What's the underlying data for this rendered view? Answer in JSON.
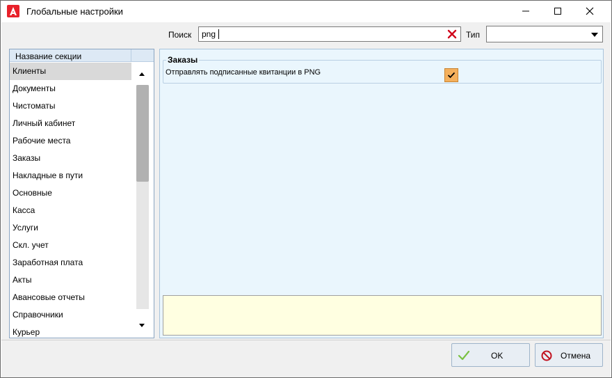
{
  "window": {
    "title": "Глобальные настройки"
  },
  "search": {
    "label": "Поиск",
    "value": "png",
    "clear_icon": "red-x-icon",
    "type_label": "Тип",
    "type_value": ""
  },
  "sections": {
    "header": "Название секции",
    "selected_index": 0,
    "items": [
      "Клиенты",
      "Документы",
      "Чистоматы",
      "Личный кабинет",
      "Рабочие места",
      "Заказы",
      "Накладные в пути",
      "Основные",
      "Касса",
      "Услуги",
      "Скл. учет",
      "Заработная плата",
      "Акты",
      "Авансовые отчеты",
      "Справочники",
      "Курьер"
    ]
  },
  "settings": {
    "group_title": "Заказы",
    "items": [
      {
        "label": "Отправлять подписанные квитанции в PNG",
        "checked": true
      }
    ],
    "description": ""
  },
  "buttons": {
    "ok": "OK",
    "cancel": "Отмена"
  },
  "colors": {
    "panel_bg": "#eaf6fd",
    "checkbox": "#f4b05c",
    "description_bg": "#ffffe1",
    "clear_icon": "#d0021b",
    "ok_icon": "#7ac142",
    "cancel_icon": "#c1121f"
  }
}
